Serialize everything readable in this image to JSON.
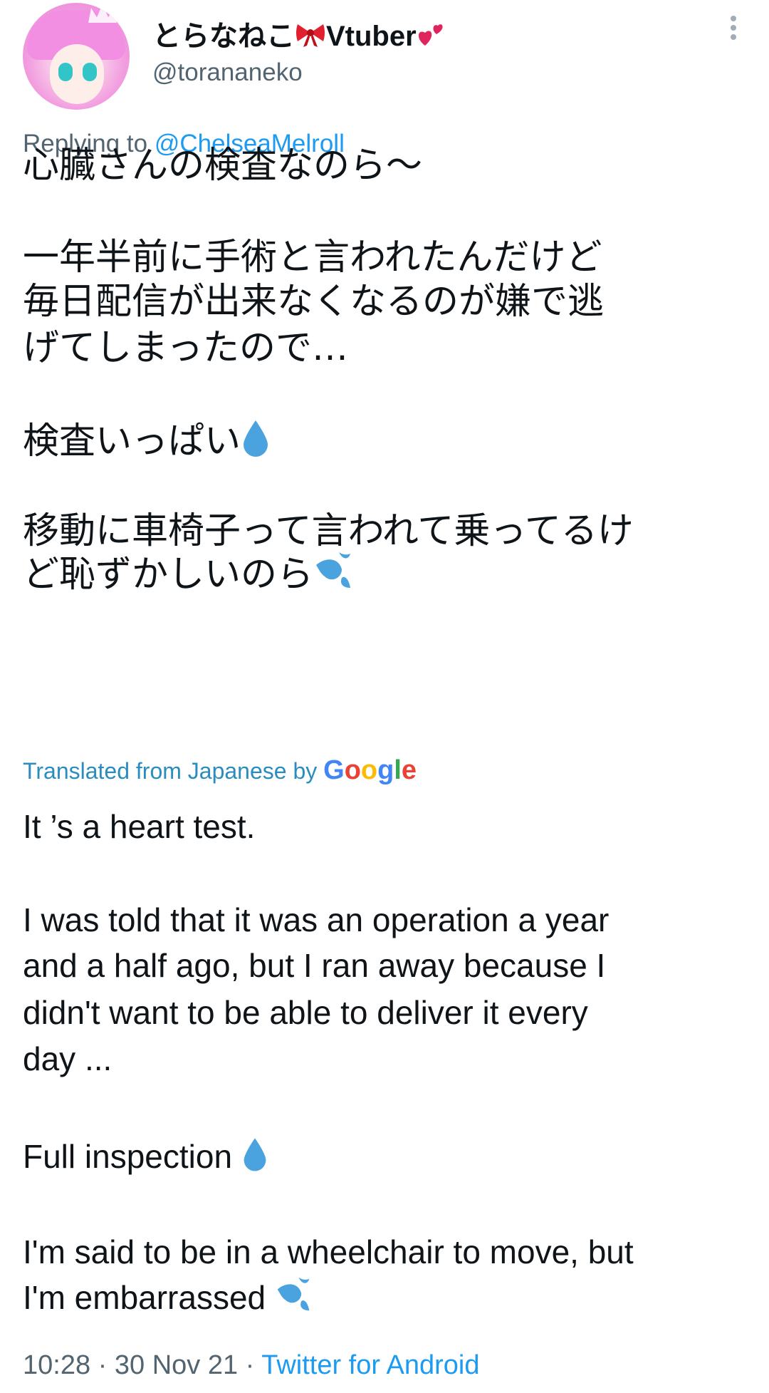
{
  "user": {
    "display_name": "とらなねこ",
    "display_name_suffix": "Vtuber",
    "handle": "@torananeko"
  },
  "reply": {
    "prefix": "Replying to ",
    "mention": "@ChelseaMelroll"
  },
  "tweet_ja": {
    "line1": "心臓さんの検査なのら〜",
    "line2": "一年半前に手術と言われたんだけど",
    "line3": "毎日配信が出来なくなるのが嫌で逃",
    "line4": "げてしまったので…",
    "line5": "検査いっぱい",
    "line6": "移動に車椅子って言われて乗ってるけ",
    "line7": "ど恥ずかしいのら"
  },
  "translation": {
    "label": "Translated from Japanese by",
    "provider": "Google"
  },
  "tweet_en": {
    "line1": "It ’s a heart test.",
    "line2": " I was told that it was an operation a year",
    "line3": "and a half ago, but I ran away because I",
    "line4": "didn't want to be able to deliver it every",
    "line5": "day ...",
    "line6": " Full inspection",
    "line7": " I'm said to be in a wheelchair to move, but",
    "line8": "I'm embarrassed"
  },
  "meta": {
    "time": "10:28",
    "separator": " · ",
    "date": "30 Nov 21",
    "source": "Twitter for Android"
  },
  "icons": {
    "ribbon": "ribbon-emoji",
    "hearts": "two-hearts-emoji",
    "droplet": "droplet-emoji",
    "sweat": "sweat-droplets-emoji",
    "more": "more-vertical-icon"
  }
}
